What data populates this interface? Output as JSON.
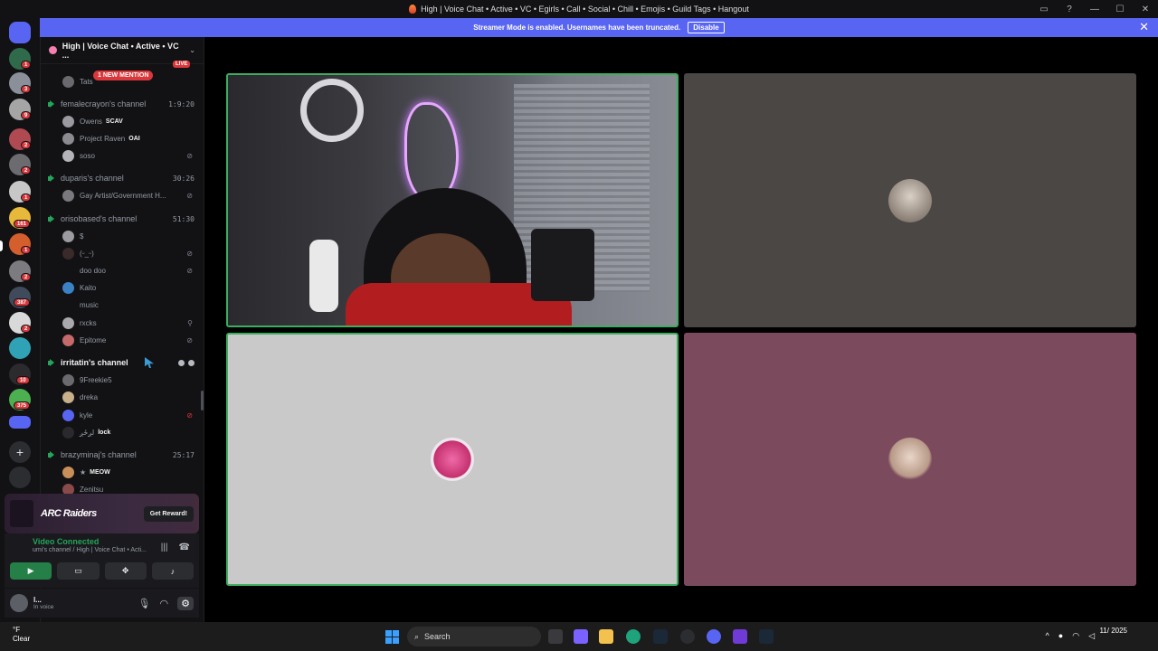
{
  "window": {
    "title": "High | Voice Chat • Active • VC • Egirls • Call • Social • Chill • Emojis • Guild Tags • Hangout",
    "controls": [
      "—",
      "☐",
      "✕"
    ]
  },
  "banner": {
    "text": "Streamer Mode is enabled. Usernames have been truncated.",
    "button": "Disable",
    "close": "✕"
  },
  "rail": {
    "badges": [
      "1",
      "3",
      "9",
      "2",
      "2",
      "1",
      "1",
      "161",
      "1",
      "2",
      "387",
      "2",
      "10",
      "375"
    ]
  },
  "guild": {
    "name": "High | Voice Chat • Active • VC ...",
    "chevron": "⌄"
  },
  "sidebar": {
    "mention": "1 NEW MENTION",
    "live": "LIVE",
    "channels": [
      {
        "name": "femalecrayon's channel",
        "time": "1:9:20"
      },
      {
        "name": "duparis's channel",
        "time": "30:26"
      },
      {
        "name": "orisobased's channel",
        "time": "51:30"
      },
      {
        "name": "irritatin's channel",
        "time": ""
      },
      {
        "name": "brazyminaj's channel",
        "time": "25:17"
      }
    ],
    "users": [
      {
        "name": "Tats",
        "tag": ""
      },
      {
        "name": "Owens",
        "tag": "SCAV"
      },
      {
        "name": "Project Raven",
        "tag": "OAI"
      },
      {
        "name": "soso",
        "tag": ""
      },
      {
        "name": "Gay Artist/Government H...",
        "tag": ""
      },
      {
        "name": "$",
        "tag": ""
      },
      {
        "name": "(ᵕ_ᵕ)",
        "tag": ""
      },
      {
        "name": "doo doo",
        "tag": ""
      },
      {
        "name": "Kaito",
        "tag": ""
      },
      {
        "name": "music",
        "tag": ""
      },
      {
        "name": "rxcks",
        "tag": ""
      },
      {
        "name": "Epitome",
        "tag": ""
      },
      {
        "name": "9Freekie5",
        "tag": ""
      },
      {
        "name": "dreka",
        "tag": ""
      },
      {
        "name": "kyle",
        "tag": ""
      },
      {
        "name": "لږځږ",
        "tag": "lock"
      },
      {
        "name": "★",
        "tag": "MEOW"
      },
      {
        "name": "Zenitsu",
        "tag": ""
      }
    ]
  },
  "promo": {
    "logo": "ARC Raiders",
    "button": "Get Reward!"
  },
  "voice": {
    "status": "Video Connected",
    "subtitle": "umi's channel / High | Voice Chat • Acti...",
    "icons": [
      "waveform-icon",
      "hangup-icon"
    ]
  },
  "userpanel": {
    "name": "l...",
    "status": "In voice"
  },
  "taskbar": {
    "temp": "°F",
    "condition": "Clear",
    "search": "Search",
    "date": "11/ 2025"
  },
  "colors": {
    "accent": "#5865f2",
    "speaking": "#3dae5f",
    "voice_green": "#23a55a",
    "alert": "#da373c"
  }
}
